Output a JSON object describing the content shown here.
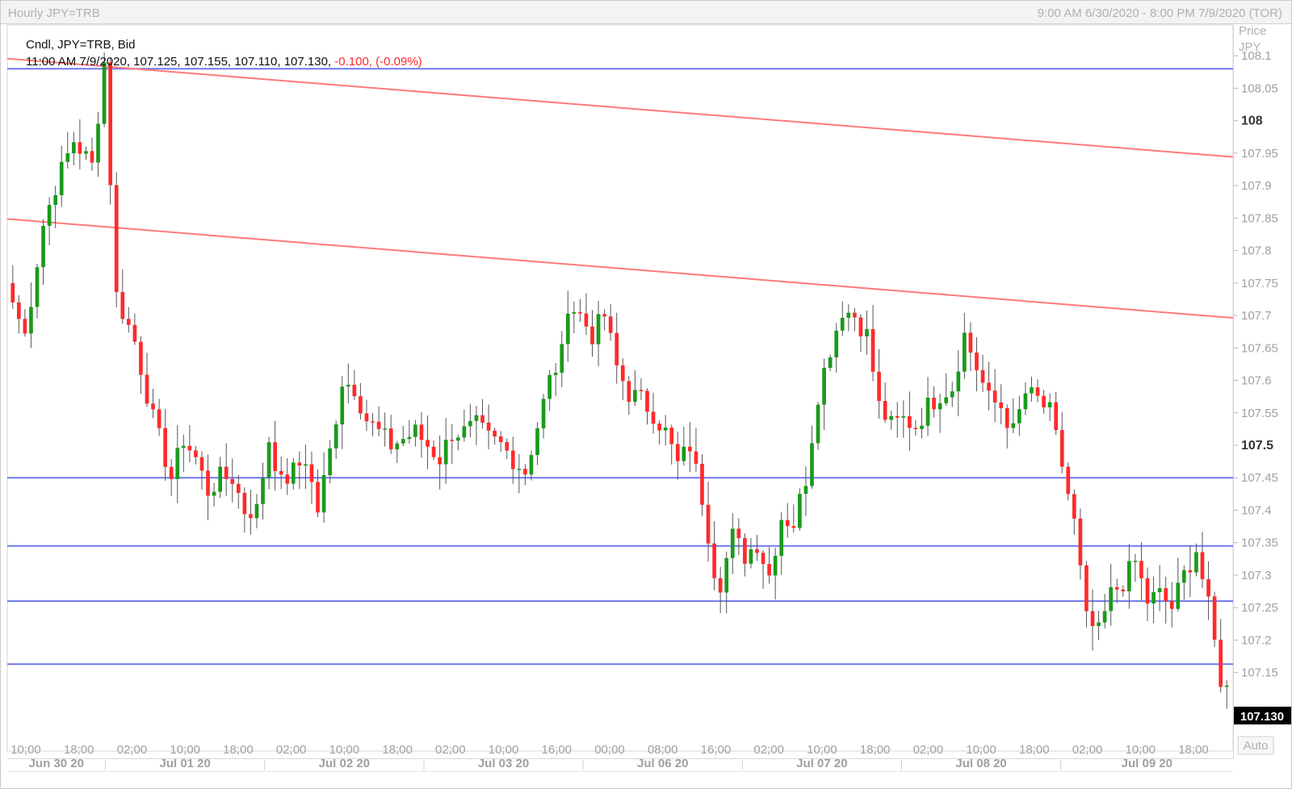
{
  "window": {
    "title": "Hourly JPY=TRB",
    "date_range": "9:00 AM 6/30/2020 - 8:00 PM 7/9/2020 (TOR)"
  },
  "legend": {
    "line1": "Cndl, JPY=TRB, Bid",
    "line2_prefix": "11:00 AM 7/9/2020, 107.125, 107.155, 107.110, 107.130, ",
    "line2_change": "-0.100, (-0.09%)"
  },
  "axis": {
    "price_label_line1": "Price",
    "price_label_line2": "JPY",
    "auto_button": "Auto",
    "current_price": "107.130"
  },
  "colors": {
    "up": "#1a9a1a",
    "down": "#ff2a2a",
    "hline": "#6f78ee",
    "trend": "#ff7a7a",
    "change_text": "#ff2a2a"
  },
  "chart_data": {
    "type": "candlestick",
    "symbol": "JPY=TRB",
    "interval": "Hourly",
    "ylim": [
      107.08,
      108.13
    ],
    "y_ticks": [
      "108.1",
      "108.05",
      "108",
      "107.95",
      "107.9",
      "107.85",
      "107.8",
      "107.75",
      "107.7",
      "107.65",
      "107.6",
      "107.55",
      "107.5",
      "107.45",
      "107.4",
      "107.35",
      "107.3",
      "107.25",
      "107.2",
      "107.15"
    ],
    "y_ticks_bold": [
      "108",
      "107.5"
    ],
    "x_tick_labels": [
      "10:00",
      "18:00",
      "02:00",
      "10:00",
      "18:00",
      "02:00",
      "10:00",
      "18:00",
      "02:00",
      "10:00",
      "16:00",
      "00:00",
      "08:00",
      "16:00",
      "02:00",
      "10:00",
      "18:00",
      "02:00",
      "10:00",
      "18:00",
      "02:00",
      "10:00",
      "18:00"
    ],
    "date_labels": [
      "Jun 30 20",
      "Jul 01 20",
      "Jul 02 20",
      "Jul 03 20",
      "Jul 06 20",
      "Jul 07 20",
      "Jul 08 20",
      "Jul 09 20"
    ],
    "horizontal_lines": [
      108.08,
      107.45,
      107.345,
      107.26,
      107.163
    ],
    "trend_lines": [
      {
        "from_bar": 0,
        "from_price": 108.095,
        "to_bar": 199,
        "to_price": 107.945
      },
      {
        "from_bar": 0,
        "from_price": 107.848,
        "to_bar": 199,
        "to_price": 107.697
      }
    ],
    "waypoints": [
      [
        0,
        107.72
      ],
      [
        2,
        107.67
      ],
      [
        5,
        107.84
      ],
      [
        7,
        107.9
      ],
      [
        10,
        107.97
      ],
      [
        13,
        107.93
      ],
      [
        15,
        108.09
      ],
      [
        17,
        107.73
      ],
      [
        20,
        107.66
      ],
      [
        23,
        107.54
      ],
      [
        26,
        107.45
      ],
      [
        28,
        107.51
      ],
      [
        30,
        107.48
      ],
      [
        32,
        107.43
      ],
      [
        34,
        107.45
      ],
      [
        36,
        107.45
      ],
      [
        38,
        107.4
      ],
      [
        40,
        107.4
      ],
      [
        42,
        107.51
      ],
      [
        44,
        107.44
      ],
      [
        46,
        107.46
      ],
      [
        48,
        107.48
      ],
      [
        50,
        107.4
      ],
      [
        52,
        107.49
      ],
      [
        54,
        107.6
      ],
      [
        56,
        107.59
      ],
      [
        58,
        107.54
      ],
      [
        60,
        107.52
      ],
      [
        62,
        107.5
      ],
      [
        64,
        107.51
      ],
      [
        66,
        107.52
      ],
      [
        68,
        107.5
      ],
      [
        70,
        107.48
      ],
      [
        72,
        107.52
      ],
      [
        74,
        107.52
      ],
      [
        76,
        107.53
      ],
      [
        78,
        107.51
      ],
      [
        80,
        107.5
      ],
      [
        82,
        107.48
      ],
      [
        84,
        107.46
      ],
      [
        86,
        107.53
      ],
      [
        88,
        107.6
      ],
      [
        90,
        107.64
      ],
      [
        91,
        107.72
      ],
      [
        93,
        107.7
      ],
      [
        95,
        107.67
      ],
      [
        97,
        107.7
      ],
      [
        99,
        107.62
      ],
      [
        101,
        107.58
      ],
      [
        103,
        107.57
      ],
      [
        105,
        107.55
      ],
      [
        107,
        107.52
      ],
      [
        109,
        107.47
      ],
      [
        111,
        107.5
      ],
      [
        113,
        107.42
      ],
      [
        115,
        107.31
      ],
      [
        116,
        107.29
      ],
      [
        118,
        107.36
      ],
      [
        120,
        107.33
      ],
      [
        122,
        107.35
      ],
      [
        124,
        107.3
      ],
      [
        126,
        107.39
      ],
      [
        128,
        107.38
      ],
      [
        130,
        107.45
      ],
      [
        132,
        107.58
      ],
      [
        134,
        107.65
      ],
      [
        136,
        107.71
      ],
      [
        138,
        107.7
      ],
      [
        140,
        107.67
      ],
      [
        142,
        107.56
      ],
      [
        144,
        107.53
      ],
      [
        146,
        107.54
      ],
      [
        148,
        107.53
      ],
      [
        150,
        107.56
      ],
      [
        152,
        107.58
      ],
      [
        154,
        107.59
      ],
      [
        156,
        107.67
      ],
      [
        158,
        107.62
      ],
      [
        160,
        107.57
      ],
      [
        162,
        107.56
      ],
      [
        164,
        107.52
      ],
      [
        166,
        107.58
      ],
      [
        168,
        107.57
      ],
      [
        170,
        107.55
      ],
      [
        172,
        107.47
      ],
      [
        174,
        107.38
      ],
      [
        176,
        107.23
      ],
      [
        178,
        107.21
      ],
      [
        180,
        107.27
      ],
      [
        182,
        107.29
      ],
      [
        184,
        107.32
      ],
      [
        186,
        107.26
      ],
      [
        188,
        107.27
      ],
      [
        190,
        107.25
      ],
      [
        192,
        107.3
      ],
      [
        194,
        107.34
      ],
      [
        196,
        107.25
      ],
      [
        198,
        107.14
      ],
      [
        199,
        107.13
      ]
    ]
  }
}
